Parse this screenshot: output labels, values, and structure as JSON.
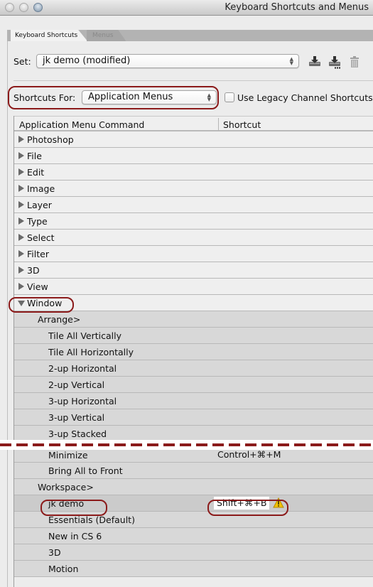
{
  "window": {
    "title": "Keyboard Shortcuts and Menus"
  },
  "tabs": [
    {
      "label": "Keyboard Shortcuts",
      "active": true
    },
    {
      "label": "Menus",
      "active": false
    }
  ],
  "set": {
    "label": "Set:",
    "value": "jk demo (modified)"
  },
  "shortcuts_for": {
    "label": "Shortcuts For:",
    "value": "Application Menus"
  },
  "legacy_checkbox": {
    "label": "Use Legacy Channel Shortcuts",
    "checked": false
  },
  "icons": {
    "save": "save-set-icon",
    "save_as": "save-set-as-icon",
    "delete": "trash-icon",
    "warning": "warning-icon"
  },
  "table": {
    "headers": {
      "command": "Application Menu Command",
      "shortcut": "Shortcut"
    },
    "top_rows": [
      {
        "label": "Photoshop",
        "shortcut": ""
      },
      {
        "label": "File",
        "shortcut": ""
      },
      {
        "label": "Edit",
        "shortcut": ""
      },
      {
        "label": "Image",
        "shortcut": ""
      },
      {
        "label": "Layer",
        "shortcut": ""
      },
      {
        "label": "Type",
        "shortcut": ""
      },
      {
        "label": "Select",
        "shortcut": ""
      },
      {
        "label": "Filter",
        "shortcut": ""
      },
      {
        "label": "3D",
        "shortcut": ""
      },
      {
        "label": "View",
        "shortcut": ""
      }
    ],
    "window_row": {
      "label": "Window",
      "expanded": true
    },
    "arrange": {
      "label": "Arrange>",
      "items": [
        "Tile All Vertically",
        "Tile All Horizontally",
        "2-up Horizontal",
        "2-up Vertical",
        "3-up Horizontal",
        "3-up Vertical",
        "3-up Stacked"
      ]
    },
    "after_break": [
      {
        "label": "Minimize",
        "shortcut": "Control+⌘+M"
      },
      {
        "label": "Bring All to Front",
        "shortcut": ""
      }
    ],
    "workspace": {
      "label": "Workspace>",
      "selected": {
        "label": "jk demo",
        "shortcut": "Shift+⌘+B"
      },
      "items": [
        "Essentials (Default)",
        "New in CS 6",
        "3D",
        "Motion"
      ]
    }
  },
  "colors": {
    "highlight": "#8b1a1a",
    "warning": "#f2c200"
  }
}
